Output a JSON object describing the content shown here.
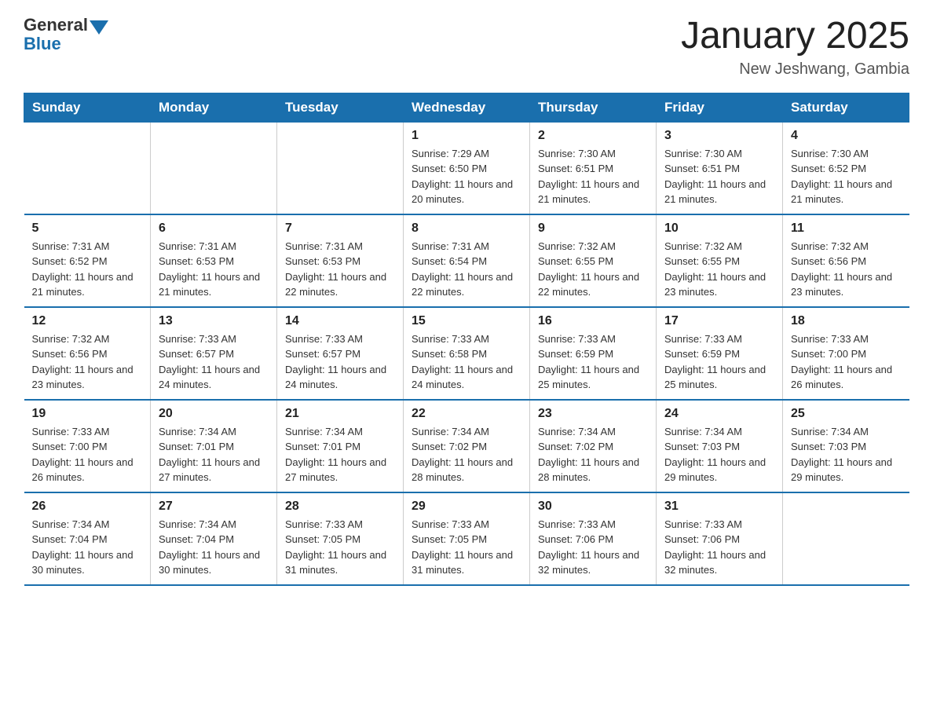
{
  "logo": {
    "line1": "General",
    "line2": "Blue"
  },
  "title": "January 2025",
  "subtitle": "New Jeshwang, Gambia",
  "days_of_week": [
    "Sunday",
    "Monday",
    "Tuesday",
    "Wednesday",
    "Thursday",
    "Friday",
    "Saturday"
  ],
  "weeks": [
    [
      {
        "day": "",
        "info": ""
      },
      {
        "day": "",
        "info": ""
      },
      {
        "day": "",
        "info": ""
      },
      {
        "day": "1",
        "info": "Sunrise: 7:29 AM\nSunset: 6:50 PM\nDaylight: 11 hours and 20 minutes."
      },
      {
        "day": "2",
        "info": "Sunrise: 7:30 AM\nSunset: 6:51 PM\nDaylight: 11 hours and 21 minutes."
      },
      {
        "day": "3",
        "info": "Sunrise: 7:30 AM\nSunset: 6:51 PM\nDaylight: 11 hours and 21 minutes."
      },
      {
        "day": "4",
        "info": "Sunrise: 7:30 AM\nSunset: 6:52 PM\nDaylight: 11 hours and 21 minutes."
      }
    ],
    [
      {
        "day": "5",
        "info": "Sunrise: 7:31 AM\nSunset: 6:52 PM\nDaylight: 11 hours and 21 minutes."
      },
      {
        "day": "6",
        "info": "Sunrise: 7:31 AM\nSunset: 6:53 PM\nDaylight: 11 hours and 21 minutes."
      },
      {
        "day": "7",
        "info": "Sunrise: 7:31 AM\nSunset: 6:53 PM\nDaylight: 11 hours and 22 minutes."
      },
      {
        "day": "8",
        "info": "Sunrise: 7:31 AM\nSunset: 6:54 PM\nDaylight: 11 hours and 22 minutes."
      },
      {
        "day": "9",
        "info": "Sunrise: 7:32 AM\nSunset: 6:55 PM\nDaylight: 11 hours and 22 minutes."
      },
      {
        "day": "10",
        "info": "Sunrise: 7:32 AM\nSunset: 6:55 PM\nDaylight: 11 hours and 23 minutes."
      },
      {
        "day": "11",
        "info": "Sunrise: 7:32 AM\nSunset: 6:56 PM\nDaylight: 11 hours and 23 minutes."
      }
    ],
    [
      {
        "day": "12",
        "info": "Sunrise: 7:32 AM\nSunset: 6:56 PM\nDaylight: 11 hours and 23 minutes."
      },
      {
        "day": "13",
        "info": "Sunrise: 7:33 AM\nSunset: 6:57 PM\nDaylight: 11 hours and 24 minutes."
      },
      {
        "day": "14",
        "info": "Sunrise: 7:33 AM\nSunset: 6:57 PM\nDaylight: 11 hours and 24 minutes."
      },
      {
        "day": "15",
        "info": "Sunrise: 7:33 AM\nSunset: 6:58 PM\nDaylight: 11 hours and 24 minutes."
      },
      {
        "day": "16",
        "info": "Sunrise: 7:33 AM\nSunset: 6:59 PM\nDaylight: 11 hours and 25 minutes."
      },
      {
        "day": "17",
        "info": "Sunrise: 7:33 AM\nSunset: 6:59 PM\nDaylight: 11 hours and 25 minutes."
      },
      {
        "day": "18",
        "info": "Sunrise: 7:33 AM\nSunset: 7:00 PM\nDaylight: 11 hours and 26 minutes."
      }
    ],
    [
      {
        "day": "19",
        "info": "Sunrise: 7:33 AM\nSunset: 7:00 PM\nDaylight: 11 hours and 26 minutes."
      },
      {
        "day": "20",
        "info": "Sunrise: 7:34 AM\nSunset: 7:01 PM\nDaylight: 11 hours and 27 minutes."
      },
      {
        "day": "21",
        "info": "Sunrise: 7:34 AM\nSunset: 7:01 PM\nDaylight: 11 hours and 27 minutes."
      },
      {
        "day": "22",
        "info": "Sunrise: 7:34 AM\nSunset: 7:02 PM\nDaylight: 11 hours and 28 minutes."
      },
      {
        "day": "23",
        "info": "Sunrise: 7:34 AM\nSunset: 7:02 PM\nDaylight: 11 hours and 28 minutes."
      },
      {
        "day": "24",
        "info": "Sunrise: 7:34 AM\nSunset: 7:03 PM\nDaylight: 11 hours and 29 minutes."
      },
      {
        "day": "25",
        "info": "Sunrise: 7:34 AM\nSunset: 7:03 PM\nDaylight: 11 hours and 29 minutes."
      }
    ],
    [
      {
        "day": "26",
        "info": "Sunrise: 7:34 AM\nSunset: 7:04 PM\nDaylight: 11 hours and 30 minutes."
      },
      {
        "day": "27",
        "info": "Sunrise: 7:34 AM\nSunset: 7:04 PM\nDaylight: 11 hours and 30 minutes."
      },
      {
        "day": "28",
        "info": "Sunrise: 7:33 AM\nSunset: 7:05 PM\nDaylight: 11 hours and 31 minutes."
      },
      {
        "day": "29",
        "info": "Sunrise: 7:33 AM\nSunset: 7:05 PM\nDaylight: 11 hours and 31 minutes."
      },
      {
        "day": "30",
        "info": "Sunrise: 7:33 AM\nSunset: 7:06 PM\nDaylight: 11 hours and 32 minutes."
      },
      {
        "day": "31",
        "info": "Sunrise: 7:33 AM\nSunset: 7:06 PM\nDaylight: 11 hours and 32 minutes."
      },
      {
        "day": "",
        "info": ""
      }
    ]
  ]
}
